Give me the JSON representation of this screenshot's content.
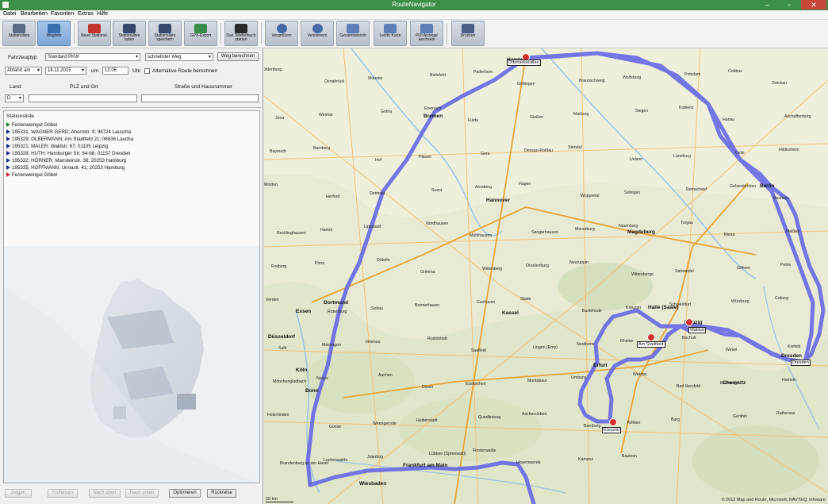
{
  "window": {
    "title": "RouteNavigator"
  },
  "menu": [
    "Datei",
    "Bearbeiten",
    "Favoriten",
    "Extras",
    "Hilfe"
  ],
  "toolbar": [
    {
      "label": "Stationsliste",
      "icon": "list-icon"
    },
    {
      "label": "Wegliste",
      "icon": "route-icon"
    },
    {
      "label": "Neue Stationsl.",
      "icon": "new-list-icon"
    },
    {
      "label": "Stationsliste laden",
      "icon": "load-list-icon"
    },
    {
      "label": "Stationsliste speichern",
      "icon": "save-list-icon"
    },
    {
      "label": "GPX-Export",
      "icon": "gpx-export-icon"
    },
    {
      "label": "Das Telefonbuch starten",
      "icon": "phonebook-icon"
    },
    {
      "label": "Vergrößern",
      "icon": "zoom-in-icon"
    },
    {
      "label": "Verkleinern",
      "icon": "zoom-out-icon"
    },
    {
      "label": "Gesamtansicht",
      "icon": "overview-icon"
    },
    {
      "label": "Letzte Karte",
      "icon": "last-map-icon"
    },
    {
      "label": "POI Anzeige wechseln",
      "icon": "poi-icon"
    },
    {
      "label": "Drucken",
      "icon": "printer-icon"
    }
  ],
  "form": {
    "vehicle_label": "Fahrzeugtyp:",
    "vehicle_value": "Standard PKW",
    "route_type_value": "schnellster Weg",
    "calc_button": "Weg berechnen",
    "depart_value": "Abfahrt am",
    "date_value": "18.11.2015",
    "at_label": "um",
    "time_value": "12:06",
    "hour_label": "Uhr",
    "alt_route_label": "Alternative Route berechnen",
    "country_label": "Land",
    "zip_city_label": "PLZ und Ort",
    "street_label": "Straße und Hausnummer",
    "country_value": "D"
  },
  "stations": {
    "header": "Stationsliste",
    "items": [
      {
        "text": "Ferienweingut Göbel",
        "flag": "start"
      },
      {
        "text": "195331; WAGNER GERD; Ahornstr. 9; 98724 Lauscha",
        "flag": "via"
      },
      {
        "text": "195329; OLBERMANN; Am Stadtfeld 21; 06636 Laucha",
        "flag": "via"
      },
      {
        "text": "195321; MALER; Waldstr. 67; 01105 Leipzig",
        "flag": "via"
      },
      {
        "text": "195328; HUTH; Hamburger Str. 64-68; 01157 Dresden",
        "flag": "via"
      },
      {
        "text": "195332; HÖRNER; Mansteinstr. 38; 20253 Hamburg",
        "flag": "via"
      },
      {
        "text": "195335; HOFFMANN; Unnastr. 41; 20253 Hamburg",
        "flag": "via"
      },
      {
        "text": "Ferienweingut Göbel",
        "flag": "end"
      }
    ]
  },
  "bottom_buttons": [
    {
      "label": "Zeigen",
      "enabled": false
    },
    {
      "label": "Entfernen",
      "enabled": false
    },
    {
      "label": "Nach oben",
      "enabled": false
    },
    {
      "label": "Nach unten",
      "enabled": false
    },
    {
      "label": "Optimieren",
      "enabled": true
    },
    {
      "label": "Rückreise",
      "enabled": true
    }
  ],
  "map": {
    "cities": [
      "Hamburg",
      "Bremen",
      "Hannover",
      "Berlin",
      "Magdeburg",
      "Leipzig",
      "Dresden",
      "Dortmund",
      "Essen",
      "Düsseldorf",
      "Köln",
      "Bonn",
      "Frankfurt am Main",
      "Erfurt",
      "Kassel",
      "Halle (Saale)",
      "Chemnitz",
      "Wiesbaden"
    ],
    "towns": [
      "Oldenburg",
      "Osnabrück",
      "Münster",
      "Bielefeld",
      "Paderborn",
      "Göttingen",
      "Braunschweig",
      "Wolfsburg",
      "Potsdam",
      "Cottbus",
      "Zwickau",
      "Jena",
      "Weimar",
      "Gotha",
      "Eisenach",
      "Fulda",
      "Gießen",
      "Marburg",
      "Siegen",
      "Koblenz",
      "Hanau",
      "Aschaffenburg",
      "Bayreuth",
      "Bamberg",
      "Hof",
      "Plauen",
      "Gera",
      "Dessau-Roßlau",
      "Stendal",
      "Uelzen",
      "Lüneburg",
      "Celle",
      "Hildesheim",
      "Minden",
      "Herford",
      "Detmold",
      "Soest",
      "Arnsberg",
      "Hagen",
      "Wuppertal",
      "Solingen",
      "Remscheid",
      "Gelsenkirchen",
      "Bochum",
      "Recklinghausen",
      "Hamm",
      "Lippstadt",
      "Nordhausen",
      "Mühlhausen",
      "Sangerhausen",
      "Merseburg",
      "Naumburg",
      "Torgau",
      "Riesa",
      "Meißen",
      "Freiberg",
      "Pirna",
      "Döbeln",
      "Grimma",
      "Wittenberg",
      "Oranienburg",
      "Neuruppin",
      "Wittenberge",
      "Salzwedel",
      "Gifhorn",
      "Peine",
      "Verden",
      "Rotenburg",
      "Soltau",
      "Bremerhaven",
      "Cuxhaven",
      "Stade",
      "Buxtehude",
      "Kreuzstr",
      "Schweinfurt",
      "Würzburg",
      "Coburg",
      "Suhl",
      "Meiningen",
      "Ilmenau",
      "Rudolstadt",
      "Saalfeld",
      "Lingen (Ems)",
      "Nordhorn",
      "Rheine",
      "Bocholt",
      "Wesel",
      "Krefeld",
      "Mönchengladbach",
      "Neuss",
      "Aachen",
      "Düren",
      "Euskirchen",
      "Montabaur",
      "Limburg",
      "Wetzlar",
      "Bad Hersfeld",
      "Eschwege",
      "Hameln",
      "Holzminden",
      "Goslar",
      "Wernigerode",
      "Halberstadt",
      "Quedlinburg",
      "Aschersleben",
      "Bernburg",
      "Köthen",
      "Burg",
      "Genthin",
      "Rathenow",
      "Brandenburg an der Havel",
      "Luckenwalde",
      "Jüterbog",
      "Lübben (Spreewald)",
      "Finsterwalde",
      "Hoyerswerda",
      "Kamenz",
      "Bautzen"
    ],
    "markers": [
      {
        "label": "Ottensekerallee"
      },
      {
        "label": "Waldstr"
      },
      {
        "label": "Am Stadtfeld"
      },
      {
        "label": "Kreuzstr"
      },
      {
        "label": "Dresden"
      }
    ],
    "copyright": "© 2012 Map and Route, Microsoft, NAVTEQ, infoware",
    "scale": "20 km"
  }
}
